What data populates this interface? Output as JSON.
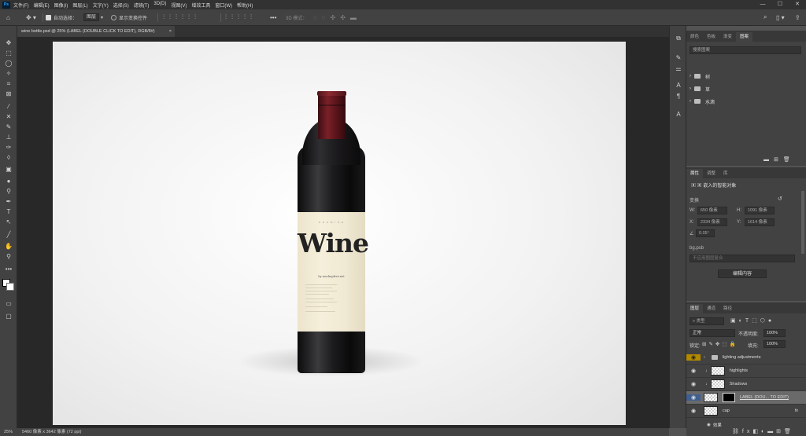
{
  "menubar": {
    "logo": "Ps",
    "items": [
      "文件(F)",
      "编辑(E)",
      "图像(I)",
      "图层(L)",
      "文字(Y)",
      "选择(S)",
      "滤镜(T)",
      "3D(D)",
      "视图(V)",
      "增效工具",
      "窗口(W)",
      "帮助(H)"
    ],
    "win": [
      "—",
      "☐",
      "✕"
    ]
  },
  "options": {
    "auto_select": "自动选择：",
    "auto_select_target": "图层",
    "show_transform": "显示变换控件",
    "mode_3d": "3D 模式："
  },
  "document": {
    "tab_title": "wine bottle.psd @ 25% (LABEL (DOUBLE CLICK TO EDIT), RGB/8#)",
    "close": "×"
  },
  "canvas": {
    "label_word": "Wine",
    "label_top": "R E D   W I N E",
    "label_sub": "by mockupfree.net",
    "colors": {
      "foil": "#7a2027",
      "glass": "#1c1b1d",
      "label": "#f2ebd6",
      "background": "#f2f2f2"
    }
  },
  "status": {
    "zoom": "25%",
    "doc_size": "5460 像素 x 3642 像素 (72 ppi)"
  },
  "panel_top": {
    "tabs": [
      "颜色",
      "色板",
      "渐变",
      "图案"
    ],
    "active": "图案",
    "search_placeholder": "搜索图案",
    "folders": [
      "树",
      "草",
      "水滴"
    ]
  },
  "properties": {
    "tabs": [
      "属性",
      "调整",
      "库"
    ],
    "active": "属性",
    "header": "嵌入的智能对象",
    "section": "变换",
    "w_label": "W:",
    "w_value": "650 像素",
    "h_label": "H:",
    "h_value": "1091 像素",
    "x_label": "X:",
    "x_value": "2334 像素",
    "y_label": "Y:",
    "y_value": "1614 像素",
    "angle": "0.05°",
    "file": "bg.psb",
    "comp": "不应用图层复合",
    "edit_button": "编辑内容"
  },
  "layers": {
    "tabs": [
      "图层",
      "通道",
      "路径"
    ],
    "active": "图层",
    "filter": "类型",
    "blend": "正常",
    "opacity_label": "不透明度:",
    "opacity": "100%",
    "lock_label": "锁定:",
    "fill_label": "填充:",
    "fill": "100%",
    "rows": [
      {
        "name": "lighting adjustments",
        "type": "group"
      },
      {
        "name": "highlights",
        "type": "layer"
      },
      {
        "name": "Shadows",
        "type": "layer"
      },
      {
        "name": "LABEL (DOU... TO EDIT)",
        "type": "smart"
      },
      {
        "name": "cap",
        "type": "layer",
        "fx": "fx"
      },
      {
        "name": "效果",
        "type": "effects"
      }
    ]
  }
}
